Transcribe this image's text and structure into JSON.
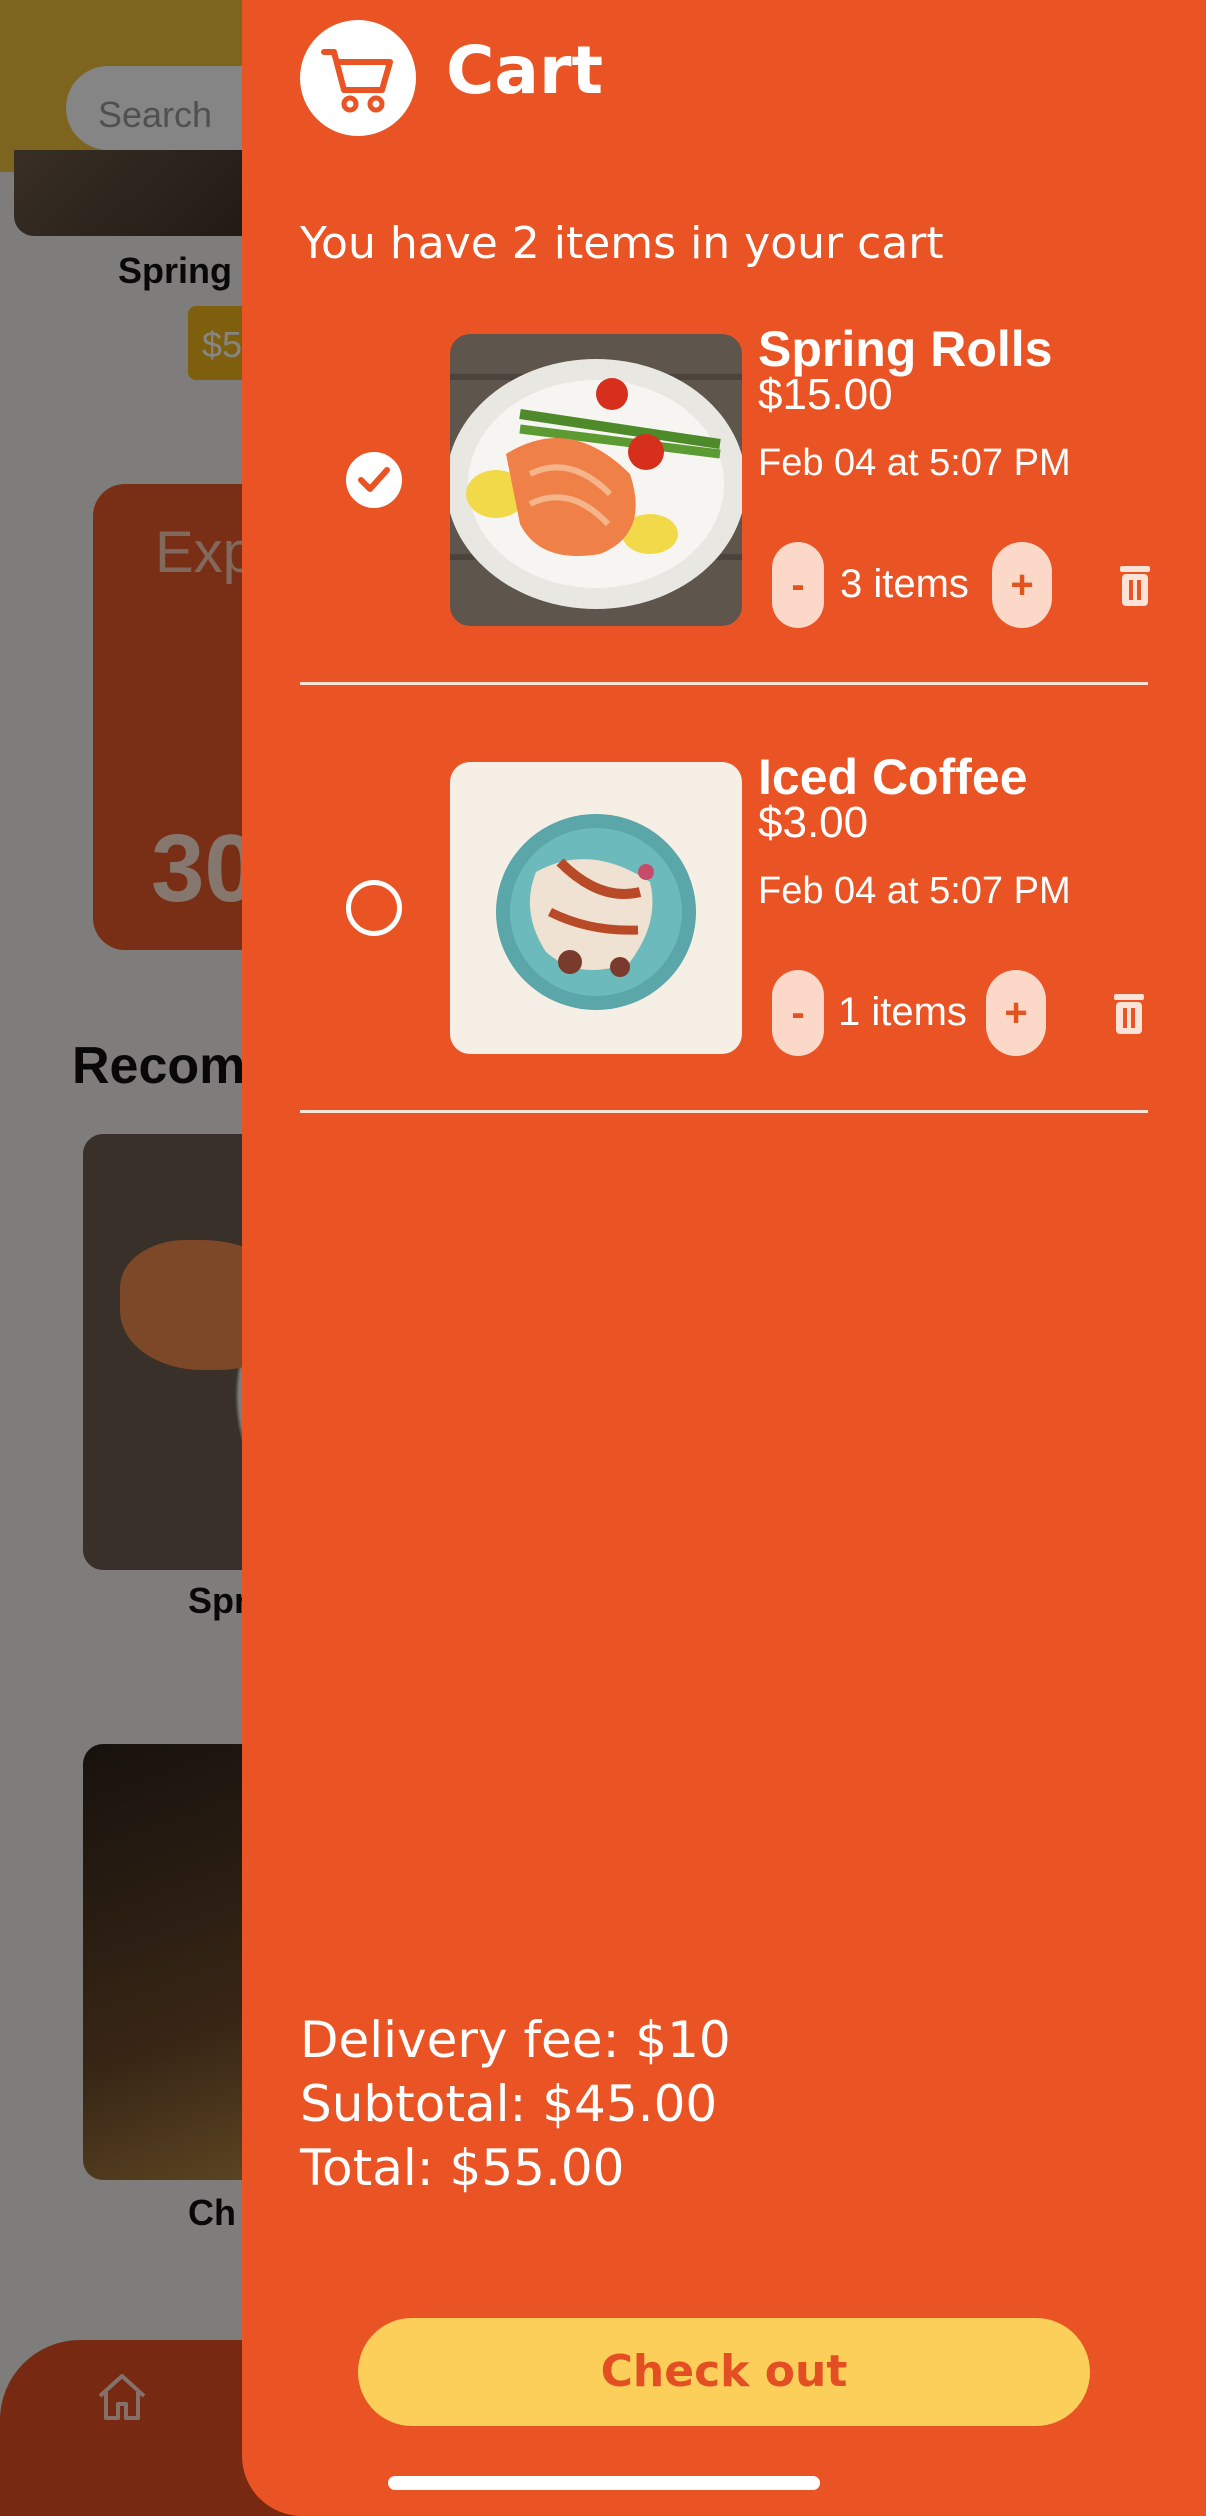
{
  "background": {
    "search_placeholder": "Search",
    "top_item_label": "Spring",
    "price_chip": "$5",
    "promo_text": "Exp our nev",
    "promo_number": "30",
    "recommended_heading": "Recom",
    "card1_label": "Spr",
    "card2_label": "Ch"
  },
  "cart": {
    "title": "Cart",
    "summary": "You have 2 items in your cart",
    "items": [
      {
        "name": "Spring Rolls",
        "price": "$15.00",
        "date": "Feb 04 at 5:07 PM",
        "quantity_label": "3 items",
        "selected": true
      },
      {
        "name": "Iced Coffee",
        "price": "$3.00",
        "date": "Feb 04 at 5:07 PM",
        "quantity_label": "1 items",
        "selected": false
      }
    ],
    "minus_label": "-",
    "plus_label": "+",
    "delivery_fee": "Delivery fee: $10",
    "subtotal": "Subtotal: $45.00",
    "total": "Total: $55.00",
    "checkout_label": "Check out"
  },
  "icons": {
    "cart": "cart-icon",
    "check": "check-icon",
    "trash": "trash-icon",
    "home": "home-icon"
  },
  "colors": {
    "drawer": "#ea5324",
    "checkout_button": "#fbcf5a",
    "checkout_text": "#e34f22",
    "qty_button": "#fbd8c8"
  }
}
